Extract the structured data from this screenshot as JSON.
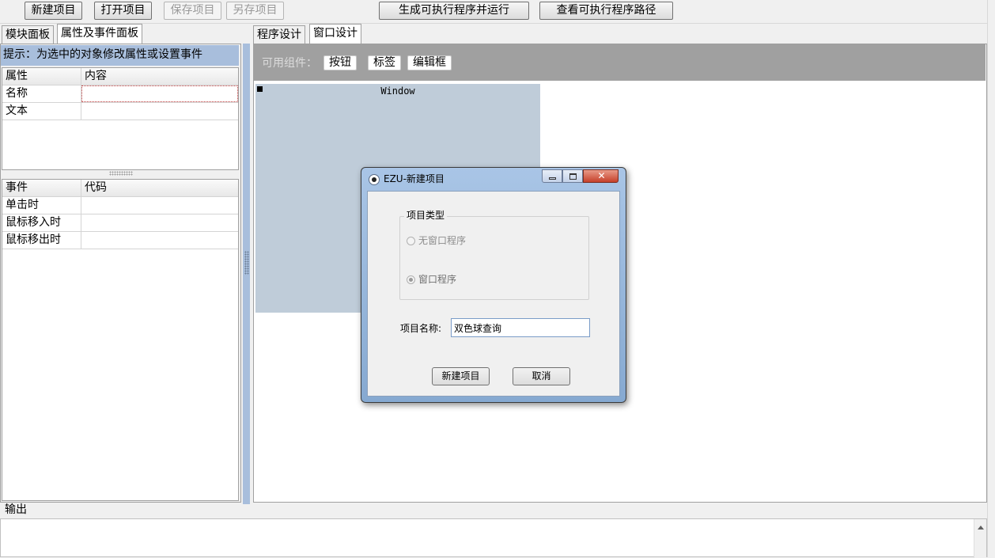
{
  "toolbar": {
    "new_project": "新建项目",
    "open_project": "打开项目",
    "save_project": "保存项目",
    "save_as": "另存项目",
    "build_run": "生成可执行程序并运行",
    "view_path": "查看可执行程序路径"
  },
  "left_tabs": [
    "模块面板",
    "属性及事件面板"
  ],
  "hint": "提示：为选中的对象修改属性或设置事件",
  "props": {
    "headers": [
      "属性",
      "内容"
    ],
    "rows": [
      [
        "名称",
        ""
      ],
      [
        "文本",
        ""
      ]
    ]
  },
  "events": {
    "headers": [
      "事件",
      "代码"
    ],
    "rows": [
      [
        "单击时",
        ""
      ],
      [
        "鼠标移入时",
        ""
      ],
      [
        "鼠标移出时",
        ""
      ]
    ]
  },
  "right_tabs": [
    "程序设计",
    "窗口设计"
  ],
  "components": {
    "label": "可用组件：",
    "items": [
      "按钮",
      "标签",
      "编辑框"
    ]
  },
  "canvas": {
    "window_label": "Window"
  },
  "output_label": "输出",
  "dialog": {
    "title": "EZU-新建项目",
    "group_title": "项目类型",
    "option_console": "无窗口程序",
    "option_window": "窗口程序",
    "selected_option": "窗口程序",
    "name_label": "项目名称:",
    "name_value": "双色球查询",
    "ok_button": "新建项目",
    "cancel_button": "取消"
  }
}
